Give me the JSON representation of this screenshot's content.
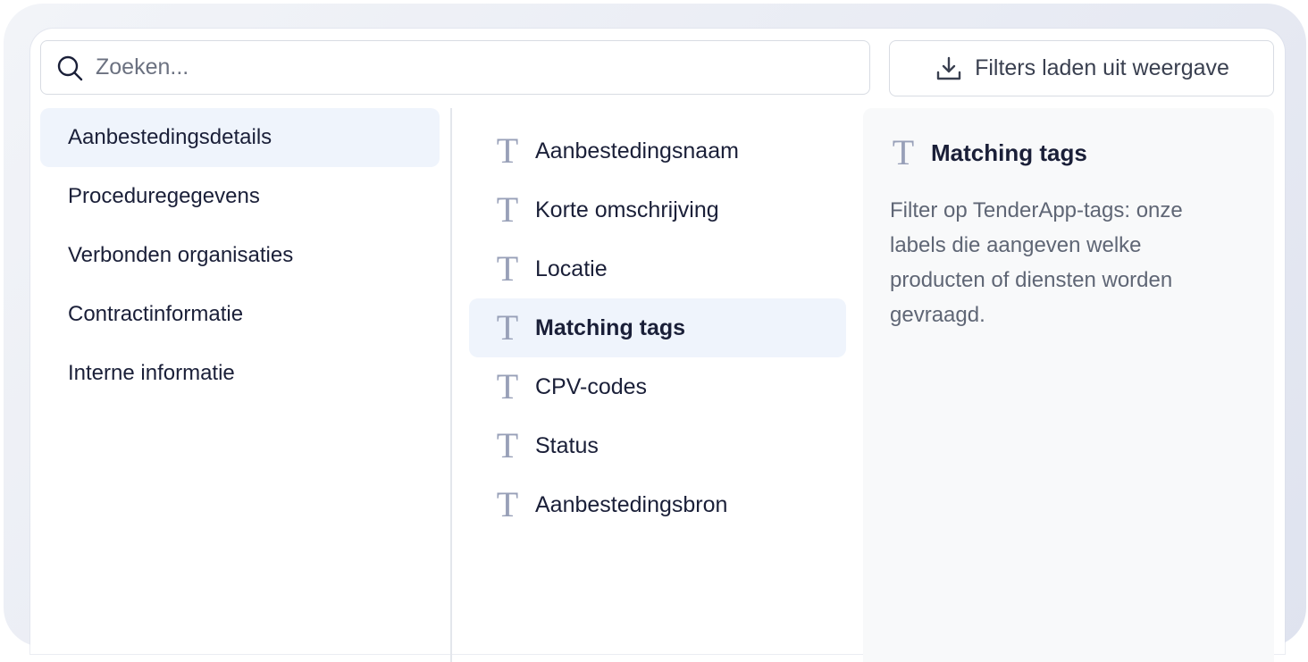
{
  "search": {
    "placeholder": "Zoeken...",
    "value": ""
  },
  "load_button": {
    "label": "Filters laden uit weergave",
    "icon": "download-icon"
  },
  "categories": [
    {
      "label": "Aanbestedingsdetails",
      "active": true
    },
    {
      "label": "Proceduregegevens",
      "active": false
    },
    {
      "label": "Verbonden organisaties",
      "active": false
    },
    {
      "label": "Contractinformatie",
      "active": false
    },
    {
      "label": "Interne informatie",
      "active": false
    }
  ],
  "fields": [
    {
      "label": "Aanbestedingsnaam",
      "icon": "text-type-icon",
      "active": false
    },
    {
      "label": "Korte omschrijving",
      "icon": "text-type-icon",
      "active": false
    },
    {
      "label": "Locatie",
      "icon": "text-type-icon",
      "active": false
    },
    {
      "label": "Matching tags",
      "icon": "text-type-icon",
      "active": true
    },
    {
      "label": "CPV-codes",
      "icon": "text-type-icon",
      "active": false
    },
    {
      "label": "Status",
      "icon": "text-type-icon",
      "active": false
    },
    {
      "label": "Aanbestedingsbron",
      "icon": "text-type-icon",
      "active": false
    }
  ],
  "details": {
    "icon_glyph": "T",
    "title": "Matching tags",
    "description": "Filter op TenderApp-tags: onze labels die aangeven welke producten of diensten worden gevraagd."
  },
  "colors": {
    "active_bg": "#eff4fc",
    "text": "#1a1f38",
    "muted": "#5f6675",
    "icon": "#98a0b8"
  }
}
